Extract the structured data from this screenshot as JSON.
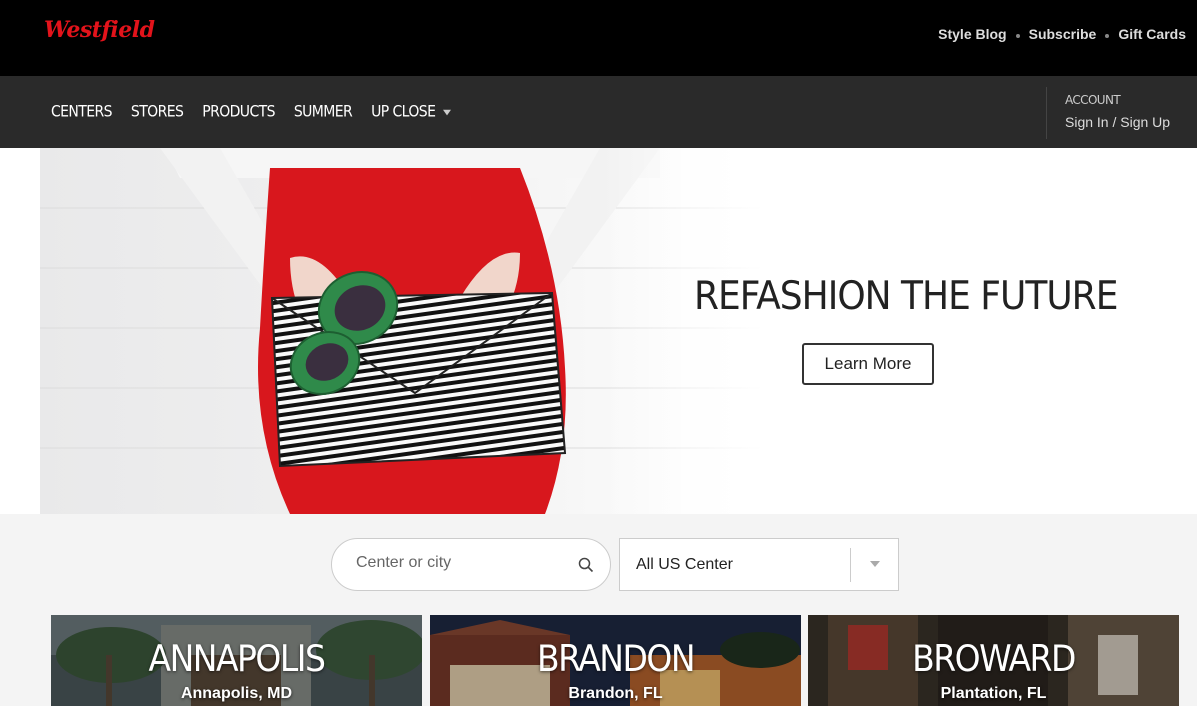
{
  "brand": {
    "logo_text": "Westfield",
    "accent": "#e3131b"
  },
  "top_links": [
    "Style Blog",
    "Subscribe",
    "Gift Cards"
  ],
  "nav": {
    "items": [
      "CENTERS",
      "STORES",
      "PRODUCTS",
      "SUMMER",
      "UP CLOSE"
    ],
    "account_label": "ACCOUNT",
    "account_link": "Sign In / Sign Up"
  },
  "hero": {
    "title": "REFASHION THE FUTURE",
    "button": "Learn More"
  },
  "search": {
    "placeholder": "Center or city",
    "select_value": "All US Center"
  },
  "centers": [
    {
      "name": "ANNAPOLIS",
      "location": "Annapolis, MD"
    },
    {
      "name": "BRANDON",
      "location": "Brandon, FL"
    },
    {
      "name": "BROWARD",
      "location": "Plantation, FL"
    }
  ]
}
